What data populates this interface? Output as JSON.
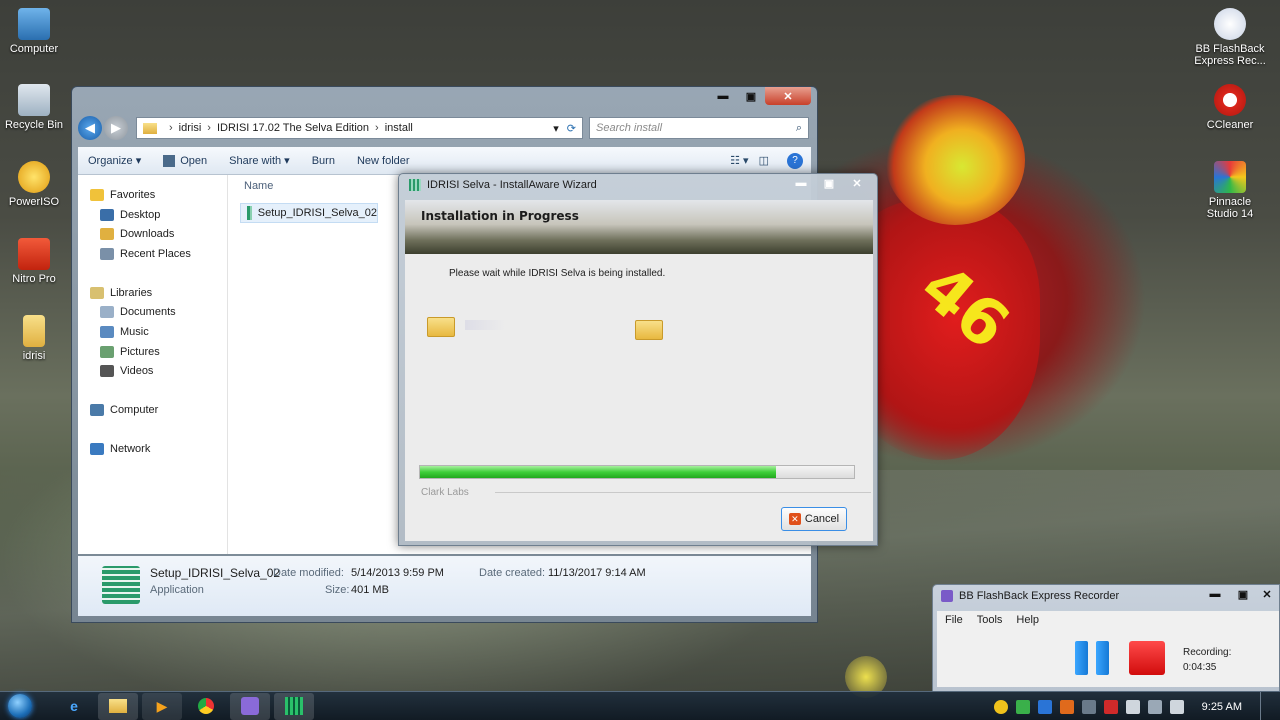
{
  "desktop": {
    "left_icons": [
      {
        "label": "Computer",
        "icon": "computer-icon"
      },
      {
        "label": "Recycle Bin",
        "icon": "recycle-bin-icon"
      },
      {
        "label": "PowerISO",
        "icon": "poweriso-icon"
      },
      {
        "label": "Nitro Pro",
        "icon": "nitro-pro-icon"
      },
      {
        "label": "idrisi",
        "icon": "folder-icon"
      }
    ],
    "right_icons": [
      {
        "label": "BB FlashBack Express Rec...",
        "icon": "bb-flashback-icon"
      },
      {
        "label": "CCleaner",
        "icon": "ccleaner-icon"
      },
      {
        "label": "Pinnacle Studio 14",
        "icon": "pinnacle-icon"
      }
    ]
  },
  "explorer": {
    "window_buttons": {
      "minimize": "▬",
      "maximize": "▣",
      "close": "✕"
    },
    "breadcrumb": [
      "idrisi",
      "IDRISI 17.02 The Selva Edition",
      "install"
    ],
    "search_placeholder": "Search install",
    "toolbar": {
      "organize": "Organize",
      "open": "Open",
      "share_with": "Share with",
      "burn": "Burn",
      "new_folder": "New folder"
    },
    "nav": {
      "favorites": "Favorites",
      "favorites_items": [
        "Desktop",
        "Downloads",
        "Recent Places"
      ],
      "libraries": "Libraries",
      "libraries_items": [
        "Documents",
        "Music",
        "Pictures",
        "Videos"
      ],
      "computer": "Computer",
      "network": "Network"
    },
    "column_name": "Name",
    "file_name": "Setup_IDRISI_Selva_02",
    "details": {
      "name": "Setup_IDRISI_Selva_02",
      "type": "Application",
      "modified_label": "Date modified:",
      "modified_value": "5/14/2013 9:59 PM",
      "size_label": "Size:",
      "size_value": "401 MB",
      "created_label": "Date created:",
      "created_value": "11/13/2017 9:14 AM"
    }
  },
  "wizard": {
    "title": "IDRISI Selva - InstallAware Wizard",
    "heading": "Installation in Progress",
    "message": "Please wait while IDRISI Selva is being installed.",
    "progress": 0.82,
    "brand": "Clark Labs",
    "cancel_label": "Cancel"
  },
  "recorder": {
    "title": "BB FlashBack Express Recorder",
    "menu": [
      "File",
      "Tools",
      "Help"
    ],
    "recording_label": "Recording:",
    "recording_time": "0:04:35"
  },
  "taskbar": {
    "clock": "9:25 AM"
  },
  "colors": {
    "accent": "#3a8ee6",
    "progress_green": "#3fcf3a",
    "stop_red": "#d10c0c"
  }
}
